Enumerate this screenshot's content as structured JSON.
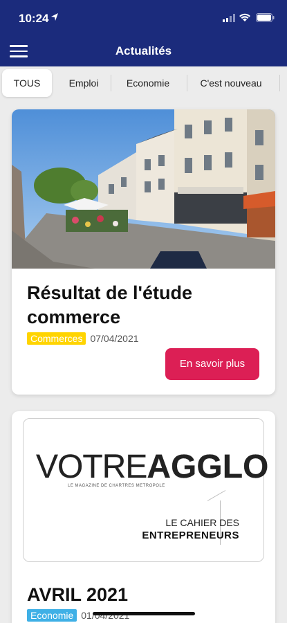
{
  "status": {
    "time": "10:24"
  },
  "header": {
    "title": "Actualités"
  },
  "tabs": [
    {
      "label": "TOUS",
      "active": true
    },
    {
      "label": "Emploi",
      "active": false
    },
    {
      "label": "Economie",
      "active": false
    },
    {
      "label": "C'est nouveau",
      "active": false
    }
  ],
  "articles": [
    {
      "title": "Résultat de l'étude commerce",
      "category": "Commerces",
      "category_color": "#ffd400",
      "date": "07/04/2021",
      "cta": "En savoir plus"
    },
    {
      "title": "AVRIL 2021",
      "category": "Economie",
      "category_color": "#3fb0e6",
      "date": "01/04/2021",
      "magazine": {
        "word1": "VOTRE",
        "word2": "AGGLO",
        "subtitle": "LE MAGAZINE DE CHARTRES METROPOLE",
        "cahier": "LE CAHIER DES",
        "entrepreneurs": "ENTREPRENEURS"
      }
    }
  ],
  "colors": {
    "navy": "#1b2b7c",
    "cta": "#dc1f55"
  },
  "icons": [
    "location-arrow-icon",
    "cellular-signal-icon",
    "wifi-icon",
    "battery-icon",
    "hamburger-menu-icon"
  ]
}
